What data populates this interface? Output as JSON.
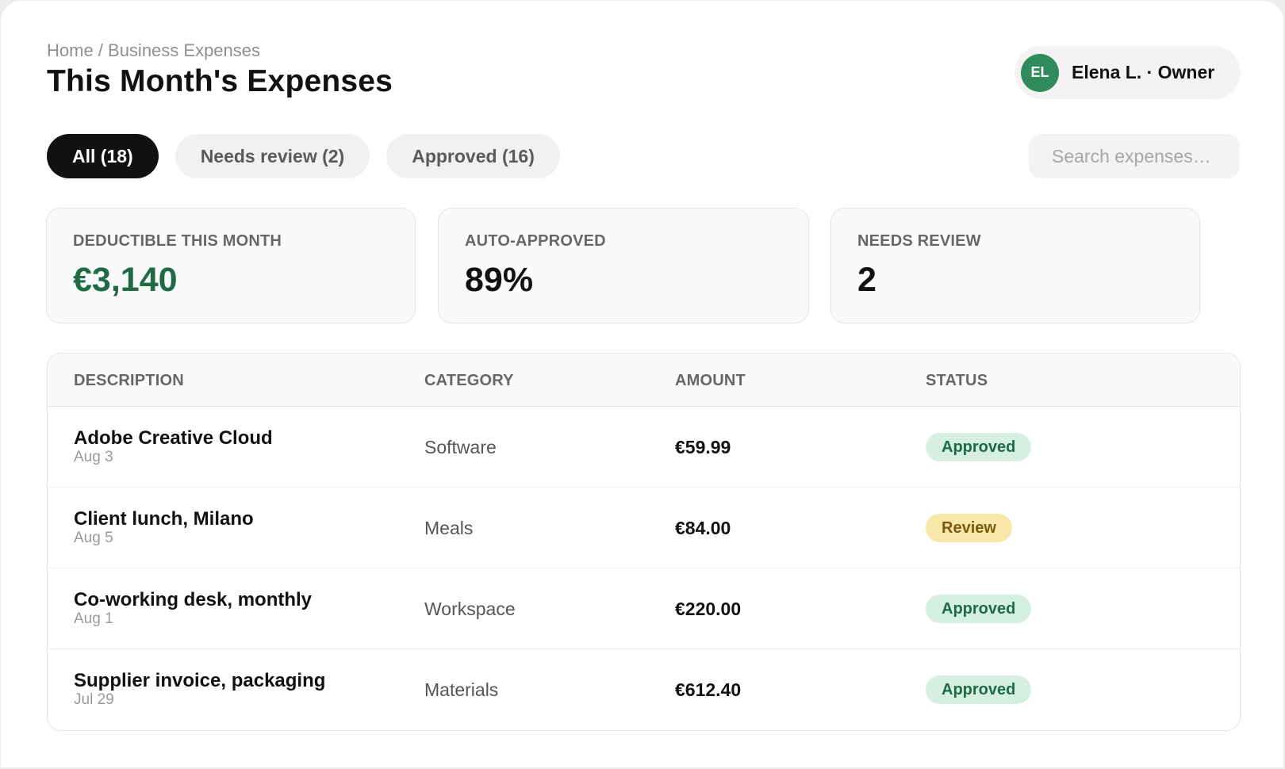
{
  "breadcrumb": "Home / Business Expenses",
  "page_title": "This Month's Expenses",
  "user": {
    "initials": "EL",
    "label": "Elena L. · Owner",
    "avatar_color": "#2f8a5c"
  },
  "tabs": [
    {
      "label": "All (18)",
      "active": true
    },
    {
      "label": "Needs review (2)",
      "active": false
    },
    {
      "label": "Approved (16)",
      "active": false
    }
  ],
  "search": {
    "placeholder": "Search expenses…",
    "value": ""
  },
  "stats": [
    {
      "label": "DEDUCTIBLE THIS MONTH",
      "value": "€3,140",
      "color": "#1f6b43"
    },
    {
      "label": "AUTO-APPROVED",
      "value": "89%"
    },
    {
      "label": "NEEDS REVIEW",
      "value": "2"
    }
  ],
  "table": {
    "columns": [
      "DESCRIPTION",
      "CATEGORY",
      "AMOUNT",
      "STATUS"
    ],
    "rows": [
      {
        "description": "Adobe Creative Cloud",
        "date": "Aug 3",
        "category": "Software",
        "amount": "€59.99",
        "status": "Approved",
        "status_kind": "approved"
      },
      {
        "description": "Client lunch, Milano",
        "date": "Aug 5",
        "category": "Meals",
        "amount": "€84.00",
        "status": "Review",
        "status_kind": "review"
      },
      {
        "description": "Co-working desk, monthly",
        "date": "Aug 1",
        "category": "Workspace",
        "amount": "€220.00",
        "status": "Approved",
        "status_kind": "approved"
      },
      {
        "description": "Supplier invoice, packaging",
        "date": "Jul 29",
        "category": "Materials",
        "amount": "€612.40",
        "status": "Approved",
        "status_kind": "approved"
      }
    ]
  },
  "colors": {
    "approved_bg": "#d6efe3",
    "approved_text": "#1e6b42",
    "review_bg": "#f8e7a8",
    "review_text": "#7b5a10",
    "active_tab": "#111111"
  }
}
